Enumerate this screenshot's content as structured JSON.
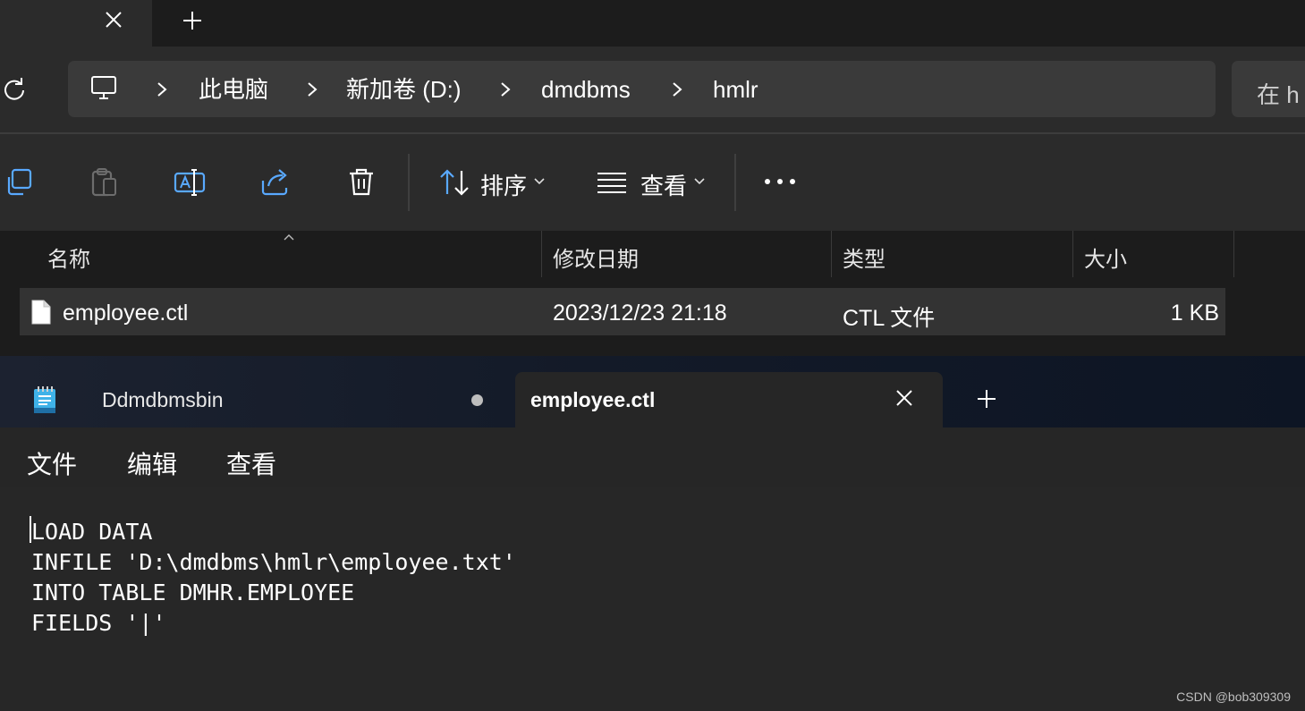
{
  "explorer": {
    "address": {
      "computer_icon": "monitor-icon",
      "crumbs": [
        "此电脑",
        "新加卷 (D:)",
        "dmdbms",
        "hmlr"
      ]
    },
    "search_placeholder": "在 h",
    "toolbar": {
      "sort_label": "排序",
      "view_label": "查看"
    },
    "columns": [
      "名称",
      "修改日期",
      "类型",
      "大小"
    ],
    "files": [
      {
        "name": "employee.ctl",
        "modified": "2023/12/23 21:18",
        "type": "CTL 文件",
        "size": "1 KB"
      }
    ]
  },
  "notepad": {
    "tabs": [
      {
        "label": "Ddmdbmsbin",
        "unsaved": true
      },
      {
        "label": "employee.ctl",
        "active": true
      }
    ],
    "menu": [
      "文件",
      "编辑",
      "查看"
    ],
    "content": "LOAD DATA\nINFILE 'D:\\dmdbms\\hmlr\\employee.txt'\nINTO TABLE DMHR.EMPLOYEE\nFIELDS '|'"
  },
  "watermark": "CSDN @bob309309",
  "colors": {
    "window_bg": "#2b2b2b",
    "editor_bg": "#272727",
    "notepad_tab_bg": "#0d1524"
  }
}
